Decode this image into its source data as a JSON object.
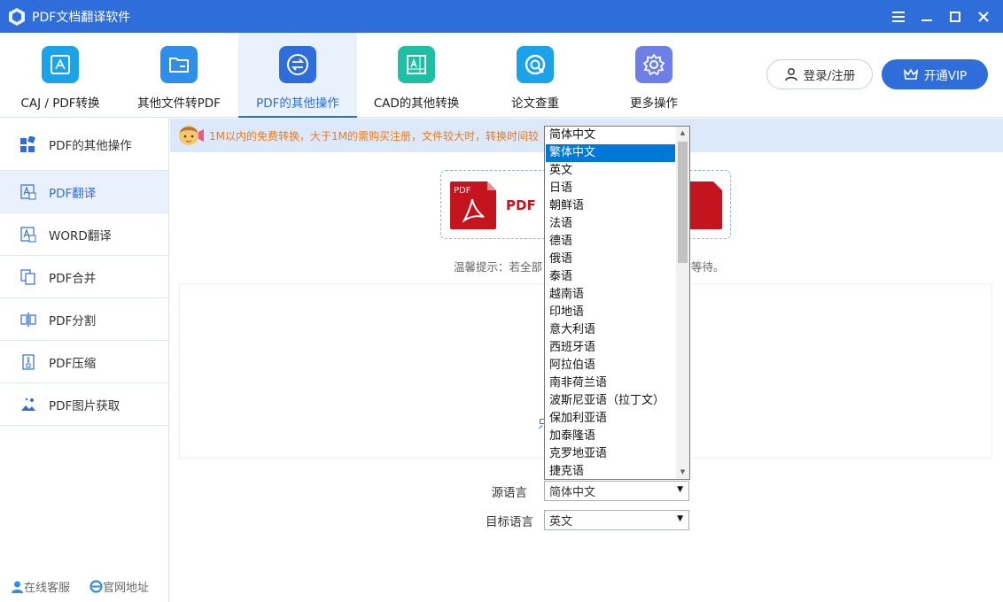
{
  "window": {
    "title": "PDF文档翻译软件",
    "controls": [
      "menu-icon",
      "minimize-icon",
      "maximize-icon",
      "close-icon"
    ]
  },
  "toolbar": {
    "tools": [
      {
        "label": "CAJ / PDF转换",
        "icon": "caj-pdf-convert-icon",
        "color": "#1aa3e8"
      },
      {
        "label": "其他文件转PDF",
        "icon": "folder-icon",
        "color": "#2f8ee8"
      },
      {
        "label": "PDF的其他操作",
        "icon": "swap-icon",
        "color": "#2f6ddb"
      },
      {
        "label": "CAD的其他转换",
        "icon": "cad-icon",
        "color": "#1ec0a3"
      },
      {
        "label": "论文查重",
        "icon": "check-icon",
        "color": "#1aa3e8"
      },
      {
        "label": "更多操作",
        "icon": "gear-icon",
        "color": "#6f7fe8"
      }
    ],
    "active_index": 2,
    "login_label": "登录/注册",
    "vip_label": "开通VIP"
  },
  "sidebar": {
    "items": [
      {
        "label": "PDF的其他操作",
        "icon": "grid-icon"
      },
      {
        "label": "PDF翻译",
        "icon": "translate-icon"
      },
      {
        "label": "WORD翻译",
        "icon": "translate-icon"
      },
      {
        "label": "PDF合并",
        "icon": "merge-icon"
      },
      {
        "label": "PDF分割",
        "icon": "split-icon"
      },
      {
        "label": "PDF压缩",
        "icon": "compress-icon"
      },
      {
        "label": "PDF图片获取",
        "icon": "image-extract-icon"
      }
    ],
    "active_index": 1,
    "footer": {
      "service_label": "在线客服",
      "website_label": "官网地址"
    }
  },
  "main": {
    "notice": "1M以内的免费转换，大于1M的需购买注册，文件较大时，转换时间较",
    "pdf_label": "PDF",
    "tip_prefix": "温馨提示：若全部",
    "tip_suffix": "等待。",
    "filearea_link": "只",
    "source_language_label": "源语言",
    "source_language_value": "简体中文",
    "target_language_label": "目标语言",
    "target_language_value": "英文"
  },
  "dropdown": {
    "options": [
      "简体中文",
      "繁体中文",
      "英文",
      "日语",
      "朝鲜语",
      "法语",
      "德语",
      "俄语",
      "泰语",
      "越南语",
      "印地语",
      "意大利语",
      "西班牙语",
      "阿拉伯语",
      "南非荷兰语",
      "波斯尼亚语（拉丁文）",
      "保加利亚语",
      "加泰隆语",
      "克罗地亚语",
      "捷克语"
    ],
    "highlighted_index": 1
  },
  "colors": {
    "accent": "#2f6ddb",
    "notice_text": "#f07a1a",
    "pdf_red": "#c4141e",
    "selection": "#0078d7"
  }
}
